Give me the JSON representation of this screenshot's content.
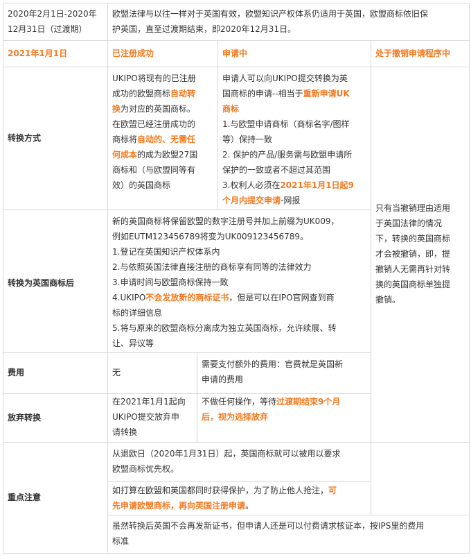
{
  "accent_color": "#f47920",
  "intro": {
    "period_lines": [
      "2020年2月1日-2020年",
      "12月31日（过渡期）"
    ],
    "desc_lines": [
      "欧盟法律与以往一样对于英国有效，欧盟知识产权体系仍适用于英国，欧盟商标依旧保",
      "护英国，直至过渡期结束，即2020年12月31日。"
    ]
  },
  "header": {
    "date": "2021年1月1日",
    "registered": "已注册成功",
    "applying": "申请中",
    "cancel_proc": "处于撤销申请程序中"
  },
  "rows": {
    "convert_method": {
      "label": "转换方式",
      "registered_lines": [
        [
          "UKIPO将现有的已注册"
        ],
        [
          "成功的欧盟商标",
          {
            "hl": "自动转"
          }
        ],
        [
          {
            "hl": "换"
          },
          "为对应的英国商标。"
        ],
        [
          "在欧盟已经注册成功的"
        ],
        [
          "商标将",
          {
            "hl": "自动的、无需任"
          }
        ],
        [
          {
            "hl": "何成本"
          },
          "的成为欧盟27国"
        ],
        [
          "商标和（与欧盟同等有"
        ],
        [
          "效）的英国商标"
        ]
      ],
      "applying_lines": [
        [
          "申请人可以向UKIPO提交转换为英"
        ],
        [
          "国商标的申请--相当于",
          {
            "hl": "重新申请UK"
          }
        ],
        [
          {
            "hl": "商标"
          }
        ],
        [
          "1.与欧盟申请商标（商标名字/图样"
        ],
        [
          "等）保持一致"
        ],
        [
          "2. 保护的产品/服务需与欧盟申请所"
        ],
        [
          "保护的一致或者不超过其范围"
        ],
        [
          "3.权利人必须在",
          {
            "hl": "2021年1月1日起9"
          }
        ],
        [
          {
            "hl": "个月内提交申请"
          },
          "-网报"
        ]
      ]
    },
    "cancel_note_lines": [
      "只有当撤销理由适用",
      "于英国法律的情况",
      "下，转换的英国商标",
      "才会被撤销，即，提",
      "撤销人无需再针对转",
      "换的英国商标单独提",
      "撤销。"
    ],
    "after_convert": {
      "label": "转换为英国商标后",
      "lines": [
        [
          "新的英国商标将保留欧盟的数字注册号并加上前缀为UK009，"
        ],
        [
          "例如EUTM123456789将变为UK009123456789。"
        ],
        [
          "1.登记在英国知识产权体系内"
        ],
        [
          "2.与依照英国法律直接注册的商标享有同等的法律效力"
        ],
        [
          "3.申请时间与欧盟商标保持一致"
        ],
        [
          "4.UKIPO",
          {
            "hl": "不会发放新的商标证书"
          },
          "，但是可以在IPO官网查到商"
        ],
        [
          "标的详细信息"
        ],
        [
          "5.将与原来的欧盟商标分离成为独立英国商标，允许续展、转"
        ],
        [
          "让、异议等"
        ]
      ]
    },
    "fee": {
      "label": "费用",
      "registered": "无",
      "applying_lines": [
        "需要支付额外的费用：官费就是英国新",
        "申请的费用"
      ]
    },
    "opt_out": {
      "label": "放弃转换",
      "registered_lines": [
        [
          "在2021年1月1起向"
        ],
        [
          "UKIPO提交放弃申"
        ],
        [
          "请转换"
        ]
      ],
      "applying_lines": [
        [
          "不做任何操作，等待",
          {
            "hl": "过渡期结束9个月"
          }
        ],
        [
          {
            "hl": "后，视为选择放弃"
          }
        ]
      ]
    },
    "notes": {
      "label": "重点注意",
      "note1_lines": [
        [
          "从退欧日（2020年1月31日）起，英国商标就可以被用以要求"
        ],
        [
          "欧盟商标优先权。"
        ]
      ],
      "note2_lines": [
        [
          "如打算在欧盟和英国都同时获得保护，为了防止他人抢注，",
          {
            "hl": "可"
          }
        ],
        [
          {
            "hl": "先申请欧盟商标，再向英国注册申请"
          },
          "。"
        ]
      ],
      "note3_lines": [
        [
          "虽然转换后英国不会再发新证书，但申请人还是可以付费请求核证本，按IPS里的费用"
        ],
        [
          "标准"
        ]
      ]
    }
  }
}
